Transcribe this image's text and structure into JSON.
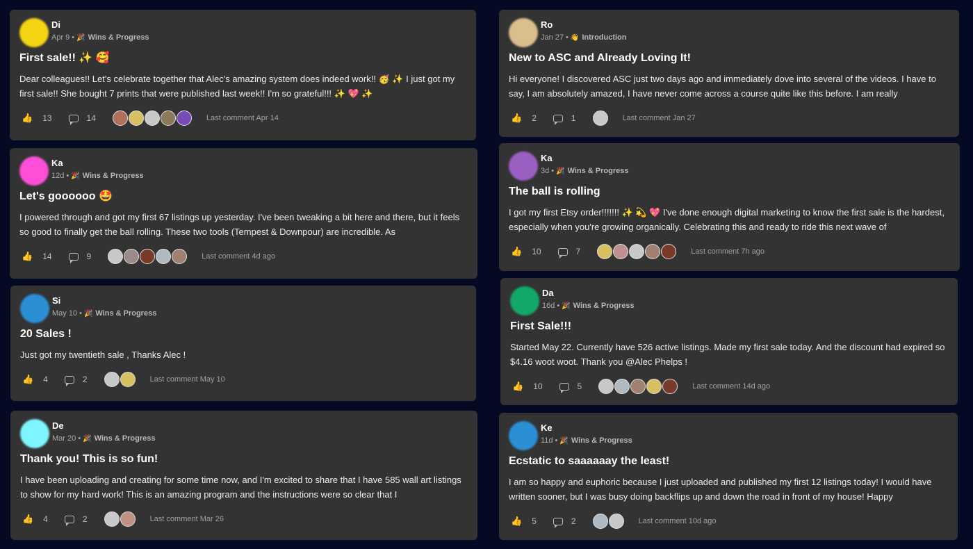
{
  "posts": [
    {
      "author": "Di",
      "avatar_color": "#f5d414",
      "date": "Apr 9",
      "category_icon": "🎉",
      "category": "Wins & Progress",
      "title": "First sale!! ✨ 🥰",
      "body": "Dear colleagues!! Let's celebrate together that Alec's amazing system does indeed work!! 🥳 ✨ I just got my first sale!! She bought 7 prints that were published last week!! I'm so grateful!!! ✨ 💖 ✨",
      "likes": "13",
      "comments": "14",
      "last_comment": "Last comment Apr 14",
      "commenters": [
        "#b0705a",
        "#d8c060",
        "#c8c8c8",
        "#8a7a5a",
        "#7a4ab8"
      ]
    },
    {
      "author": "Ka",
      "avatar_color": "#ff4fd8",
      "date": "12d",
      "category_icon": "🎉",
      "category": "Wins & Progress",
      "title": "Let's goooooo 🤩",
      "body": "I powered through and got my first 67 listings up yesterday. I've been tweaking a bit here and there, but it feels so good to finally get the ball rolling. These two tools (Tempest & Downpour) are incredible. As",
      "likes": "14",
      "comments": "9",
      "last_comment": "Last comment 4d ago",
      "commenters": [
        "#c8c8c8",
        "#9a8a8a",
        "#7a3a2a",
        "#b0b8c0",
        "#a08070"
      ]
    },
    {
      "author": "Si",
      "avatar_color": "#2b8fd6",
      "date": "May 10",
      "category_icon": "🎉",
      "category": "Wins & Progress",
      "title": "20 Sales !",
      "body": "Just got my twentieth sale , Thanks Alec !",
      "likes": "4",
      "comments": "2",
      "last_comment": "Last comment May 10",
      "commenters": [
        "#c8c8c8",
        "#d8c060"
      ]
    },
    {
      "author": "De",
      "avatar_color": "#7ff5ff",
      "date": "Mar 20",
      "category_icon": "🎉",
      "category": "Wins & Progress",
      "title": "Thank you! This is so fun!",
      "body": "I have been uploading and creating for some time now, and I'm excited to share that I have 585 wall art listings to show for my hard work! This is an amazing program and the instructions were so clear that I",
      "likes": "4",
      "comments": "2",
      "last_comment": "Last comment Mar 26",
      "commenters": [
        "#c8c8c8",
        "#c09080"
      ]
    },
    {
      "author": "Ro",
      "avatar_color": "#d9bf8c",
      "date": "Jan 27",
      "category_icon": "👋",
      "category": "Introduction",
      "title": "New to ASC and Already Loving It!",
      "body": "Hi everyone! I discovered ASC just two days ago and immediately dove into several of the videos. I have to say, I am absolutely amazed, I have never come across a course quite like this before. I am really",
      "likes": "2",
      "comments": "1",
      "last_comment": "Last comment Jan 27",
      "commenters": [
        "#c8c8c8"
      ]
    },
    {
      "author": "Ka",
      "avatar_color": "#9b5fc4",
      "date": "3d",
      "category_icon": "🎉",
      "category": "Wins & Progress",
      "title": "The ball is rolling",
      "body": "I got my first Etsy order!!!!!!! ✨ 💫 💖 I've done enough digital marketing to know the first sale is the hardest, especially when you're growing organically. Celebrating this and ready to ride this next wave of",
      "likes": "10",
      "comments": "7",
      "last_comment": "Last comment 7h ago",
      "commenters": [
        "#d8c060",
        "#c09090",
        "#c8c8c8",
        "#a08070",
        "#7a3a2a"
      ]
    },
    {
      "author": "Da",
      "avatar_color": "#12a86a",
      "date": "16d",
      "category_icon": "🎉",
      "category": "Wins & Progress",
      "title": "First Sale!!!",
      "body": "Started May 22. Currently have 526 active listings. Made my first sale today. And the discount had expired so $4.16 woot woot. Thank you @Alec Phelps !",
      "likes": "10",
      "comments": "5",
      "last_comment": "Last comment 14d ago",
      "commenters": [
        "#c8c8c8",
        "#b0b8c0",
        "#a08070",
        "#d8c060",
        "#7a3a2a"
      ]
    },
    {
      "author": "Ke",
      "avatar_color": "#2b8fd6",
      "date": "11d",
      "category_icon": "🎉",
      "category": "Wins & Progress",
      "title": "Ecstatic to saaaaaay the least!",
      "body": "I am so happy and euphoric because I just uploaded and published my first 12 listings today! I would have written sooner, but I was busy doing backflips up and down the road in front of my house! Happy",
      "likes": "5",
      "comments": "2",
      "last_comment": "Last comment 10d ago",
      "commenters": [
        "#b0b8c0",
        "#c8c8c8"
      ]
    }
  ]
}
